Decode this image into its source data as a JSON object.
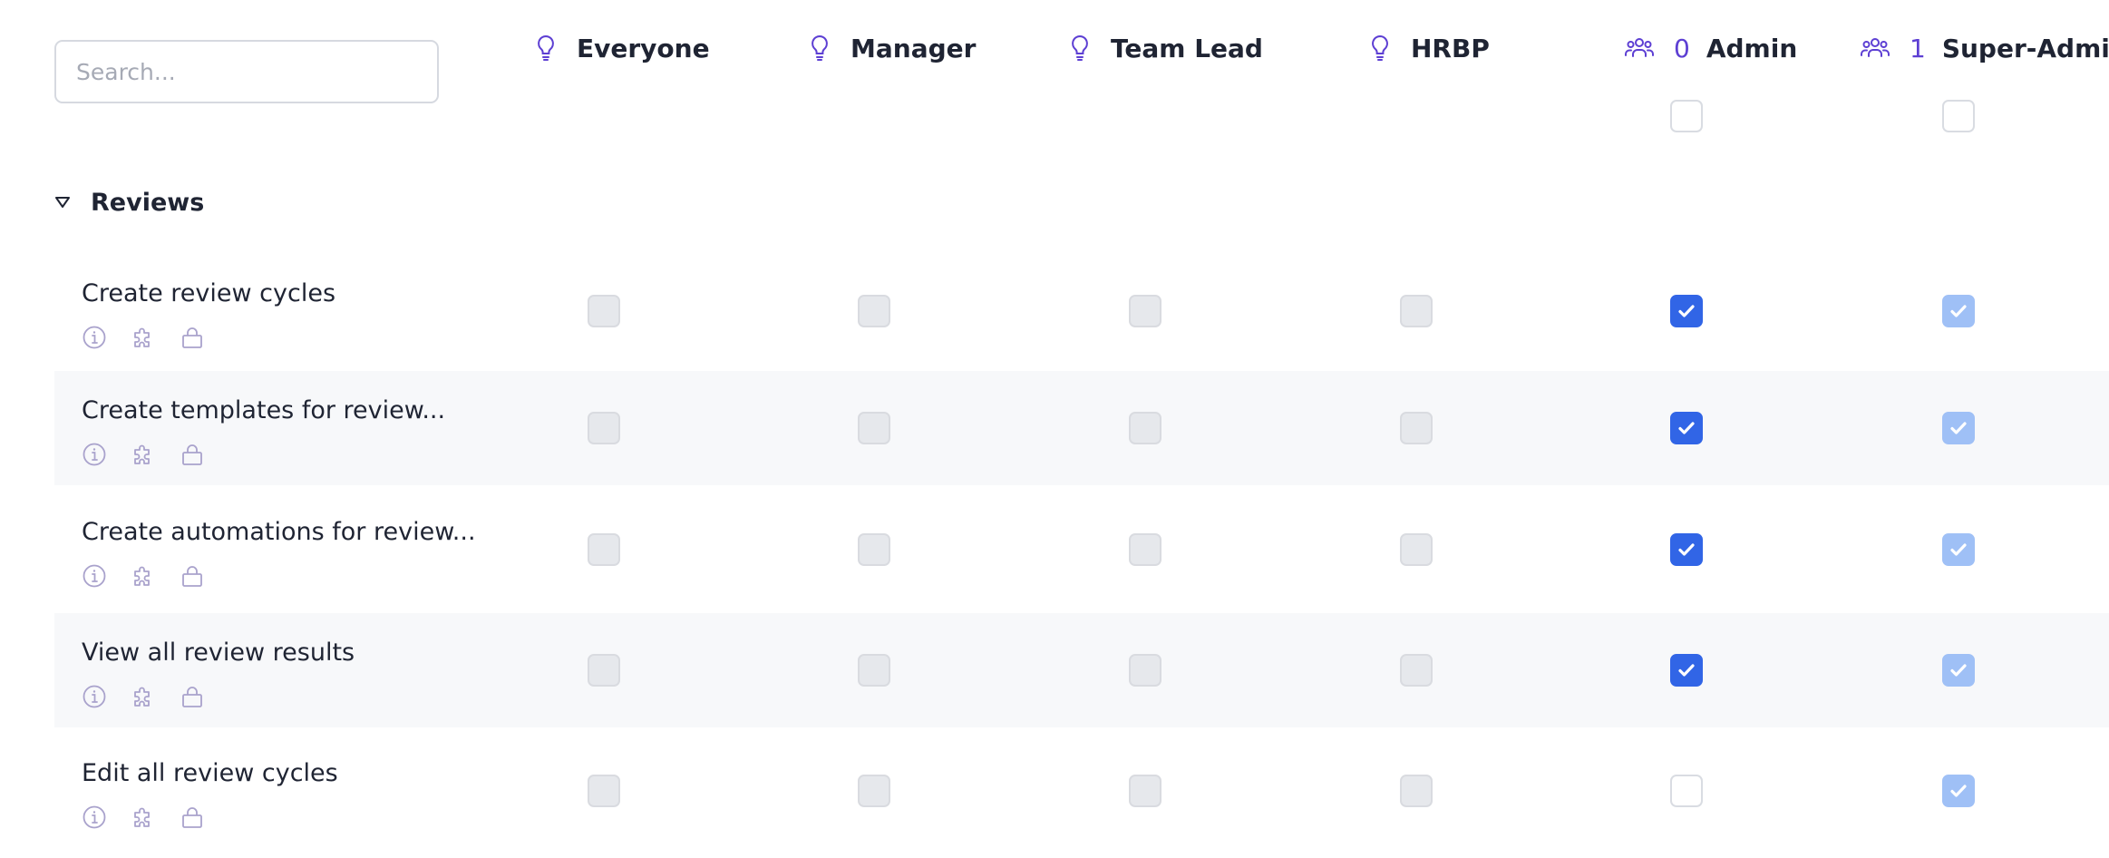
{
  "search": {
    "placeholder": "Search..."
  },
  "columns": [
    {
      "label": "Everyone",
      "icon": "lightbulb-icon",
      "count": ""
    },
    {
      "label": "Manager",
      "icon": "lightbulb-icon",
      "count": ""
    },
    {
      "label": "Team Lead",
      "icon": "lightbulb-icon",
      "count": ""
    },
    {
      "label": "HRBP",
      "icon": "lightbulb-icon",
      "count": ""
    },
    {
      "label": "Admin",
      "icon": "users-group-icon",
      "count": "0"
    },
    {
      "label": "Super-Admin",
      "icon": "users-group-icon",
      "count": "1"
    }
  ],
  "section": {
    "title": "Reviews",
    "expanded": true
  },
  "row_icons": [
    "info-icon",
    "puzzle-icon",
    "lock-icon"
  ],
  "rows": [
    {
      "label": "Create review cycles",
      "states": [
        "disabled",
        "disabled",
        "disabled",
        "disabled",
        "checked",
        "checked-light"
      ]
    },
    {
      "label": "Create templates for review...",
      "states": [
        "disabled",
        "disabled",
        "disabled",
        "disabled",
        "checked",
        "checked-light"
      ]
    },
    {
      "label": "Create automations for review...",
      "states": [
        "disabled",
        "disabled",
        "disabled",
        "disabled",
        "checked",
        "checked-light"
      ]
    },
    {
      "label": "View all review results",
      "states": [
        "disabled",
        "disabled",
        "disabled",
        "disabled",
        "checked",
        "checked-light"
      ]
    },
    {
      "label": "Edit all review cycles",
      "states": [
        "disabled",
        "disabled",
        "disabled",
        "disabled",
        "empty",
        "checked-light"
      ]
    }
  ],
  "colors": {
    "accent": "#5d3fd3",
    "checked": "#3165e6",
    "checked_light": "#9fc0f6",
    "disabled": "#e6e8ec",
    "row_alt": "#f7f8fa"
  }
}
